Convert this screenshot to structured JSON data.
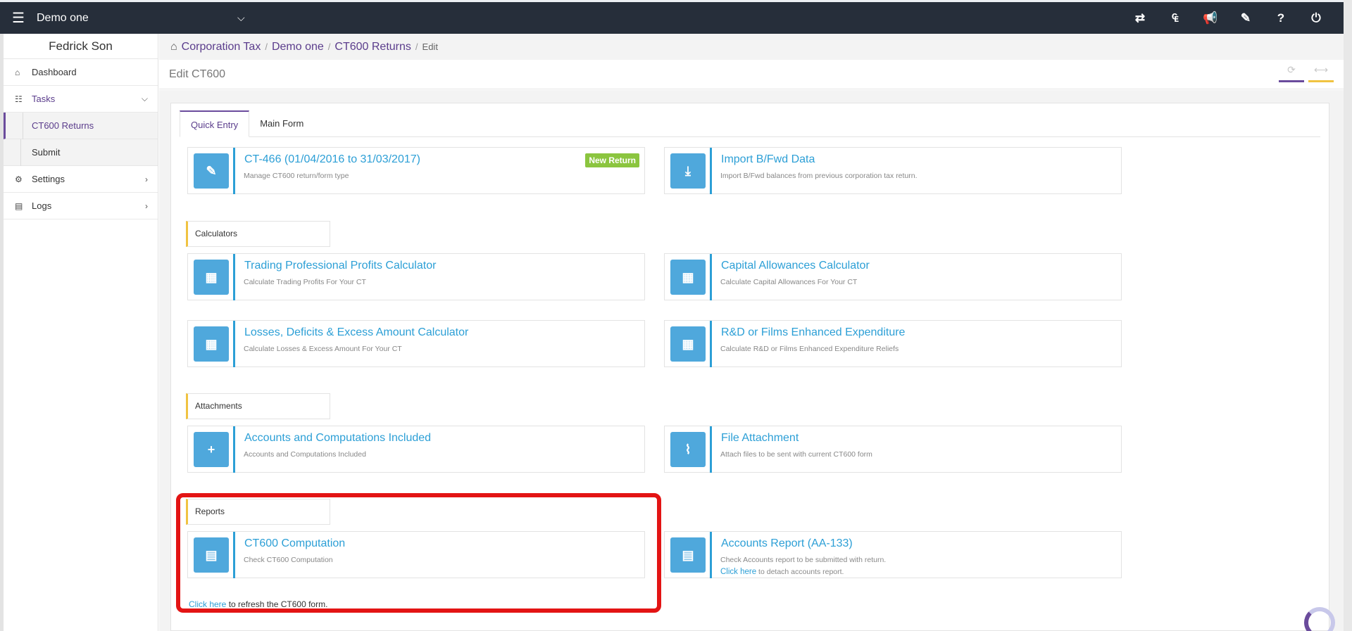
{
  "topbar": {
    "company": "Demo one",
    "menu_icon": "hamburger-icon",
    "dropdown_icon": "chevron-down-icon",
    "icons": [
      "exchange-icon",
      "currency-icon",
      "megaphone-icon",
      "ticket-icon",
      "help-icon",
      "power-icon"
    ],
    "icon_glyphs": [
      "⇄",
      "₠",
      "📢",
      "✎",
      "?",
      "⏻"
    ]
  },
  "sidebar": {
    "user": "Fedrick Son",
    "dashboard": "Dashboard",
    "tasks": "Tasks",
    "ct600_returns": "CT600 Returns",
    "submit": "Submit",
    "settings": "Settings",
    "logs": "Logs"
  },
  "breadcrumb": {
    "items": [
      "Corporation Tax",
      "Demo one",
      "CT600 Returns"
    ],
    "current": "Edit",
    "separator": "/"
  },
  "page": {
    "title": "Edit CT600"
  },
  "tabs": [
    "Quick Entry",
    "Main Form"
  ],
  "cards": {
    "return": {
      "title": "CT-466 (01/04/2016 to 31/03/2017)",
      "desc": "Manage CT600 return/form type",
      "badge": "New Return"
    },
    "import": {
      "title": "Import B/Fwd Data",
      "desc": "Import B/Fwd balances from previous corporation tax return."
    },
    "trading": {
      "title": "Trading Professional Profits Calculator",
      "desc": "Calculate Trading Profits For Your CT"
    },
    "capital": {
      "title": "Capital Allowances Calculator",
      "desc": "Calculate Capital Allowances For Your CT"
    },
    "losses": {
      "title": "Losses, Deficits & Excess Amount Calculator",
      "desc": "Calculate Losses & Excess Amount For Your CT"
    },
    "rnd": {
      "title": "R&D or Films Enhanced Expenditure",
      "desc": "Calculate R&D or Films Enhanced Expenditure Reliefs"
    },
    "accounts_included": {
      "title": "Accounts and Computations Included",
      "desc": "Accounts and Computations Included"
    },
    "file_attachment": {
      "title": "File Attachment",
      "desc": "Attach files to be sent with current CT600 form"
    },
    "ct600_computation": {
      "title": "CT600 Computation",
      "desc": "Check CT600 Computation"
    },
    "accounts_report": {
      "title": "Accounts Report (AA-133)",
      "desc": "Check Accounts report to be submitted with return.",
      "link": "Click here",
      "link_suffix": " to detach accounts report."
    }
  },
  "sections": {
    "calculators": "Calculators",
    "attachments": "Attachments",
    "reports": "Reports"
  },
  "refresh": {
    "link": "Click here",
    "suffix": " to refresh the CT600 form."
  },
  "colors": {
    "topbar": "#262e3a",
    "accent_purple": "#6a4b9c",
    "link_blue": "#2c9fd6",
    "badge_green": "#8bc53f",
    "section_yellow": "#f0c341",
    "highlight_red": "#e31414"
  }
}
